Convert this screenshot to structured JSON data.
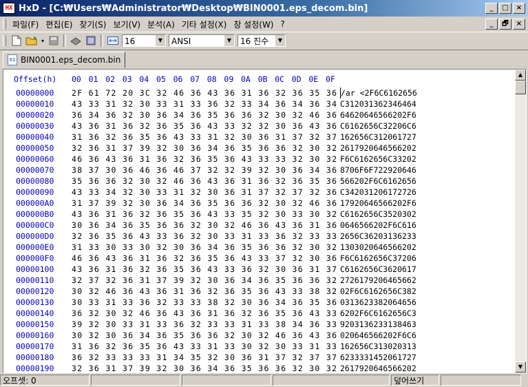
{
  "window": {
    "app_icon": "HX",
    "title": "HxD - [C:₩Users₩Administrator₩Desktop₩BIN0001.eps_decom.bin]",
    "buttons": [
      "_",
      "□",
      "×"
    ],
    "mdi_buttons": [
      "_",
      "🗗",
      "×"
    ]
  },
  "menu": [
    "파일(F)",
    "편집(E)",
    "찾기(S)",
    "보기(V)",
    "분석(A)",
    "기타 설정(X)",
    "창 설정(W)",
    "?"
  ],
  "toolbar": {
    "bytes_per_row": "16",
    "charset": "ANSI",
    "offset_base": "16 진수"
  },
  "tab": {
    "label": "BIN0001.eps_decom.bin"
  },
  "hex": {
    "header_offset": "Offset(h)",
    "columns": [
      "00",
      "01",
      "02",
      "03",
      "04",
      "05",
      "06",
      "07",
      "08",
      "09",
      "0A",
      "0B",
      "0C",
      "0D",
      "0E",
      "0F"
    ],
    "rows": [
      {
        "offset": "00000000",
        "bytes": "2F 61 72 20 3C 32 46 36 43 36 31 36 32 36 35 36",
        "ascii": "/ar <2F6C6162656"
      },
      {
        "offset": "00000010",
        "bytes": "43 33 31 32 30 33 31 33 36 32 33 34 36 34 36 34",
        "ascii": "C312031362346464"
      },
      {
        "offset": "00000020",
        "bytes": "36 34 36 32 30 36 34 36 35 36 36 32 30 32 46 36",
        "ascii": "64620646566202F6"
      },
      {
        "offset": "00000030",
        "bytes": "43 36 31 36 32 36 35 36 43 33 32 32 30 36 43 36",
        "ascii": "C6162656C32206C6"
      },
      {
        "offset": "00000040",
        "bytes": "31 36 32 36 35 36 43 33 31 32 30 36 31 37 32 37",
        "ascii": "162656C312061727"
      },
      {
        "offset": "00000050",
        "bytes": "32 36 31 37 39 32 30 36 34 36 35 36 36 32 30 32",
        "ascii": "2617920646566202"
      },
      {
        "offset": "00000060",
        "bytes": "46 36 43 36 31 36 32 36 35 36 43 33 33 32 30 32",
        "ascii": "F6C6162656C33202"
      },
      {
        "offset": "00000070",
        "bytes": "38 37 30 36 46 36 46 37 32 32 39 32 30 36 34 36",
        "ascii": "8706F6F722920646"
      },
      {
        "offset": "00000080",
        "bytes": "35 36 36 32 30 32 46 36 43 36 31 36 32 36 35 36",
        "ascii": "566202F6C6162656"
      },
      {
        "offset": "00000090",
        "bytes": "43 33 34 32 30 33 31 32 30 36 31 37 32 37 32 36",
        "ascii": "C342031206172726"
      },
      {
        "offset": "000000A0",
        "bytes": "31 37 39 32 30 36 34 36 35 36 36 32 30 32 46 36",
        "ascii": "17920646566202F6"
      },
      {
        "offset": "000000B0",
        "bytes": "43 36 31 36 32 36 35 36 43 33 35 32 30 33 30 32",
        "ascii": "C6162656C3520302"
      },
      {
        "offset": "000000C0",
        "bytes": "30 36 34 36 35 36 36 32 30 32 46 36 43 36 31 36",
        "ascii": "0646566202F6C616"
      },
      {
        "offset": "000000D0",
        "bytes": "32 36 35 36 43 33 36 32 30 33 31 33 36 32 33 33",
        "ascii": "2656C36203136233"
      },
      {
        "offset": "000000E0",
        "bytes": "31 33 30 33 30 32 30 36 34 36 35 36 36 32 30 32",
        "ascii": "1303020646566202"
      },
      {
        "offset": "000000F0",
        "bytes": "46 36 43 36 31 36 32 36 35 36 43 33 37 32 30 36",
        "ascii": "F6C6162656C37206"
      },
      {
        "offset": "00000100",
        "bytes": "43 36 31 36 32 36 35 36 43 33 36 32 30 36 31 37",
        "ascii": "C6162656C3620617"
      },
      {
        "offset": "00000110",
        "bytes": "32 37 32 36 31 37 39 32 30 36 34 36 35 36 36 32",
        "ascii": "2726179206465662"
      },
      {
        "offset": "00000120",
        "bytes": "30 32 46 36 43 36 31 36 32 36 35 36 43 33 38 32",
        "ascii": "02F6C6162656C382"
      },
      {
        "offset": "00000130",
        "bytes": "30 33 31 33 36 32 33 33 38 32 30 36 34 36 35 36",
        "ascii": "0313623382064656"
      },
      {
        "offset": "00000140",
        "bytes": "36 32 30 32 46 36 43 36 31 36 32 36 35 36 43 33",
        "ascii": "6202F6C6162656C3"
      },
      {
        "offset": "00000150",
        "bytes": "39 32 30 33 31 33 36 32 33 33 31 33 38 34 36 33",
        "ascii": "9203136233138463"
      },
      {
        "offset": "00000160",
        "bytes": "30 32 30 36 34 36 35 36 36 32 30 32 46 36 43 36",
        "ascii": "020646566202F6C6"
      },
      {
        "offset": "00000170",
        "bytes": "31 36 32 36 35 36 43 33 31 33 30 32 30 33 31 33",
        "ascii": "162656C313020313"
      },
      {
        "offset": "00000180",
        "bytes": "36 32 33 33 33 31 34 35 32 30 36 31 37 32 37 37",
        "ascii": "6233331452061727"
      },
      {
        "offset": "00000190",
        "bytes": "32 36 31 37 39 32 30 36 34 36 35 36 36 32 30 32",
        "ascii": "2617920646566202"
      }
    ]
  },
  "status": {
    "offset": "오프셋: 0",
    "mode": "덮어쓰기"
  }
}
